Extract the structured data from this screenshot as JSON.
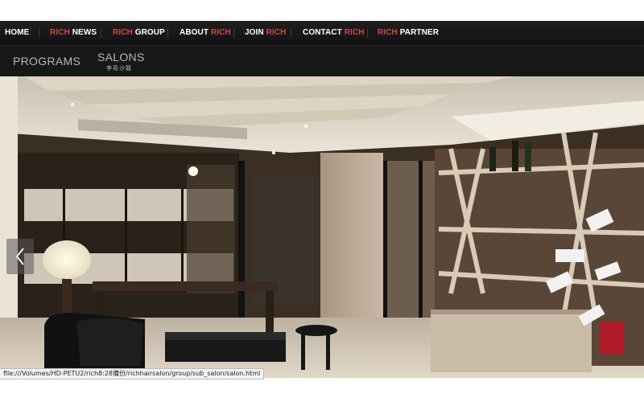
{
  "colors": {
    "accent": "#d2444a",
    "nav_text": "#ffffff",
    "sub_text": "#b8b8b8",
    "bar": "#141414"
  },
  "nav": {
    "items": [
      {
        "pre": "HOME",
        "accent": "",
        "post": ""
      },
      {
        "pre": "",
        "accent": "RICH",
        "post": " NEWS"
      },
      {
        "pre": "",
        "accent": "RICH",
        "post": " GROUP"
      },
      {
        "pre": "ABOUT ",
        "accent": "RICH",
        "post": ""
      },
      {
        "pre": "JOIN ",
        "accent": "RICH",
        "post": ""
      },
      {
        "pre": "CONTACT ",
        "accent": "RICH",
        "post": ""
      },
      {
        "pre": "",
        "accent": "RICH",
        "post": " PARTNER"
      }
    ]
  },
  "subnav": {
    "programs": "PROGRAMS",
    "salons": "SALONS",
    "salons_caption": "李奇沙龍"
  },
  "hero": {
    "icon": "chevron-left-icon"
  },
  "status": {
    "url": "file:///Volumes/HD-PETU2/rich8:28備份/richhairsalon/group/sub_salon/salon.html"
  }
}
